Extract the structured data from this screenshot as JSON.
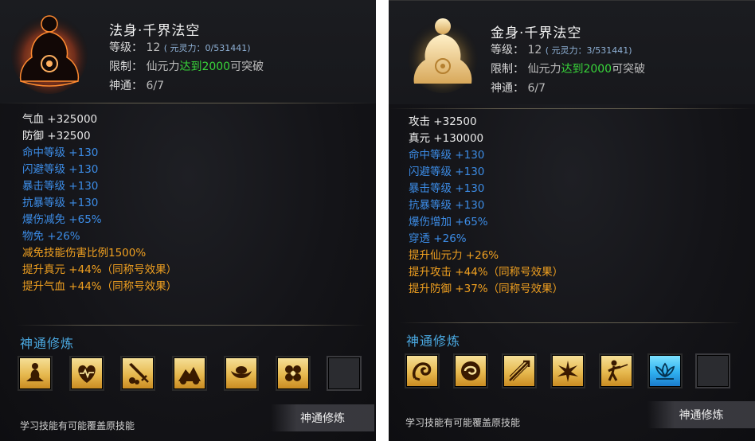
{
  "left": {
    "title": "法身·千界法空",
    "level_label": "等级：",
    "level_value": "12",
    "level_sub": "( 元灵力：0/531441)",
    "limit_label": "限制：",
    "limit_prefix": "仙元力",
    "limit_highlight": "达到2000",
    "limit_suffix": "可突破",
    "shentong_label": "神通：",
    "shentong_value": "6/7",
    "stats_white": [
      {
        "name": "气血",
        "value": "+325000"
      },
      {
        "name": "防御",
        "value": "+32500"
      }
    ],
    "stats_blue": [
      {
        "name": "命中等级",
        "value": "+130"
      },
      {
        "name": "闪避等级",
        "value": "+130"
      },
      {
        "name": "暴击等级",
        "value": "+130"
      },
      {
        "name": "抗暴等级",
        "value": "+130"
      },
      {
        "name": "爆伤减免",
        "value": "+65%"
      },
      {
        "name": "物免",
        "value": "+26%"
      }
    ],
    "stats_orange": [
      {
        "name": "减免技能伤害比例1500%",
        "value": ""
      },
      {
        "name": "提升真元",
        "value": "+44%（同称号效果）"
      },
      {
        "name": "提升气血",
        "value": "+44%（同称号效果）"
      }
    ],
    "section_title": "神通修炼",
    "skills": [
      "meditate-icon",
      "heart-icon",
      "sword-icon",
      "mountain-icon",
      "ingot-icon",
      "flower-icon",
      "empty"
    ],
    "hint": "学习技能有可能覆盖原技能",
    "button": "神通修炼"
  },
  "right": {
    "title": "金身·千界法空",
    "level_label": "等级：",
    "level_value": "12",
    "level_sub": "( 元灵力：3/531441)",
    "limit_label": "限制：",
    "limit_prefix": "仙元力",
    "limit_highlight": "达到2000",
    "limit_suffix": "可突破",
    "shentong_label": "神通：",
    "shentong_value": "6/7",
    "stats_white": [
      {
        "name": "攻击",
        "value": "+32500"
      },
      {
        "name": "真元",
        "value": "+130000"
      }
    ],
    "stats_blue": [
      {
        "name": "命中等级",
        "value": "+130"
      },
      {
        "name": "闪避等级",
        "value": "+130"
      },
      {
        "name": "暴击等级",
        "value": "+130"
      },
      {
        "name": "抗暴等级",
        "value": "+130"
      },
      {
        "name": "爆伤增加",
        "value": "+65%"
      },
      {
        "name": "穿透",
        "value": "+26%"
      }
    ],
    "stats_orange": [
      {
        "name": "提升仙元力",
        "value": "+26%"
      },
      {
        "name": "提升攻击",
        "value": "+44%（同称号效果）"
      },
      {
        "name": "提升防御",
        "value": "+37%（同称号效果）"
      }
    ],
    "section_title": "神通修炼",
    "skills": [
      "dragon-icon",
      "swirl-icon",
      "arrow-icon",
      "burst-icon",
      "warrior-icon",
      "lotus-icon",
      "empty"
    ],
    "hint": "学习技能有可能覆盖原技能",
    "button": "神通修炼"
  },
  "colors": {
    "blue_stat": "#3c8ce6",
    "orange_stat": "#f0a020",
    "green_highlight": "#38d63a",
    "section_title": "#4aa8e0"
  }
}
